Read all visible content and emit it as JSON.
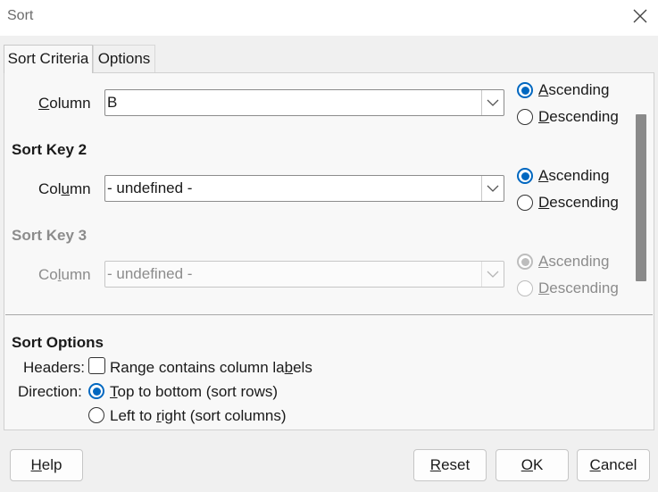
{
  "window": {
    "title": "Sort"
  },
  "tabs": [
    {
      "label": "Sort Criteria"
    },
    {
      "label": "Options"
    }
  ],
  "sort_key_1": {
    "column_label": "Column",
    "column_value": "B",
    "ascending_label": "Ascending",
    "descending_label": "Descending",
    "selected": "ascending"
  },
  "sort_key_2": {
    "title": "Sort Key 2",
    "column_label": "Column",
    "column_value": "- undefined -",
    "ascending_label": "Ascending",
    "descending_label": "Descending",
    "selected": "ascending"
  },
  "sort_key_3": {
    "title": "Sort Key 3",
    "column_label": "Column",
    "column_value": "- undefined -",
    "ascending_label": "Ascending",
    "descending_label": "Descending",
    "selected": "ascending",
    "disabled": true
  },
  "sort_options": {
    "title": "Sort Options",
    "headers_label": "Headers:",
    "headers_checkbox_label": "Range contains column labels",
    "headers_checked": false,
    "direction_label": "Direction:",
    "top_to_bottom_label": "Top to bottom (sort rows)",
    "left_to_right_label": "Left to right (sort columns)",
    "direction_selected": "top_to_bottom"
  },
  "footer": {
    "help_label": "Help",
    "reset_label": "Reset",
    "ok_label": "OK",
    "cancel_label": "Cancel"
  },
  "colors": {
    "accent": "#0067c0",
    "background": "#f0f0f0",
    "disabled_text": "#8c8c8c"
  }
}
